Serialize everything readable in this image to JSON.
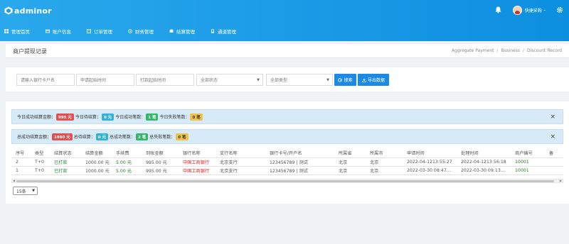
{
  "app": {
    "name": "adminor"
  },
  "header": {
    "user_name": "快捷采购",
    "caret": "⌄"
  },
  "nav": [
    {
      "label": "管理首页",
      "icon": "grid-icon"
    },
    {
      "label": "账户信息",
      "icon": "card-icon"
    },
    {
      "label": "订单管理",
      "icon": "order-icon"
    },
    {
      "label": "财务管理",
      "icon": "finance-icon"
    },
    {
      "label": "结算管理",
      "icon": "settle-icon"
    },
    {
      "label": "通道管理",
      "icon": "channel-icon"
    }
  ],
  "page": {
    "title": "商户提现记录",
    "breadcrumb": [
      "Aggregate Payment",
      "Business",
      "Discount Record"
    ]
  },
  "filters": {
    "card_name_placeholder": "请输入银行卡户名",
    "apply_start_placeholder": "申请起始时间",
    "pay_start_placeholder": "打款起始时间",
    "status_value": "全部状态",
    "type_value": "全部类型",
    "search_label": "搜索",
    "export_label": "导出数据"
  },
  "summary_today": {
    "paid_amount_label": "今日成功结算金额：",
    "paid_amount": "995 元",
    "pending_label": "今日待结算：",
    "pending": "0 元",
    "success_count_label": "今日成功笔数：",
    "success_count": "1 笔",
    "fail_count_label": "今日失败笔数：",
    "fail_count": "0 笔"
  },
  "summary_total": {
    "paid_amount_label": "总成功结算金额：",
    "paid_amount": "1990 元",
    "pending_label": "总待结算：",
    "pending": "0 元",
    "success_count_label": "总成功笔数：",
    "success_count": "2 笔",
    "fail_count_label": "总失败笔数：",
    "fail_count": "0 笔"
  },
  "table": {
    "columns": [
      "序号",
      "类型",
      "结算状态",
      "结算金额",
      "手续费",
      "到账金额",
      "银行名称",
      "支行名称",
      "银行卡号/开户名",
      "所属省",
      "所属市",
      "申请时间",
      "处理时间",
      "商户编号",
      "备"
    ],
    "rows": [
      [
        "2",
        "T+0",
        "已打款",
        "1000.00 元",
        "5.00 元",
        "995.00 元",
        "中国工商银行",
        "北京支行",
        "123456789 | 测试",
        "北京",
        "北京",
        "2022-04-1213:55:27",
        "2022-04-1213:56:18",
        "10001",
        ""
      ],
      [
        "1",
        "T+0",
        "已打款",
        "1000.00 元",
        "5.00 元",
        "995.00 元",
        "中国工商银行",
        "北京支行",
        "123456789 | 测试",
        "北京",
        "北京",
        "2022-03-30 08:47...",
        "2022-03-30 09:13...",
        "10001",
        ""
      ]
    ]
  },
  "pagination": {
    "page_size": "15条"
  },
  "colors": {
    "header_start": "#2aa8ec",
    "header_end": "#0d8fe0",
    "primary": "#1a8ae6"
  }
}
